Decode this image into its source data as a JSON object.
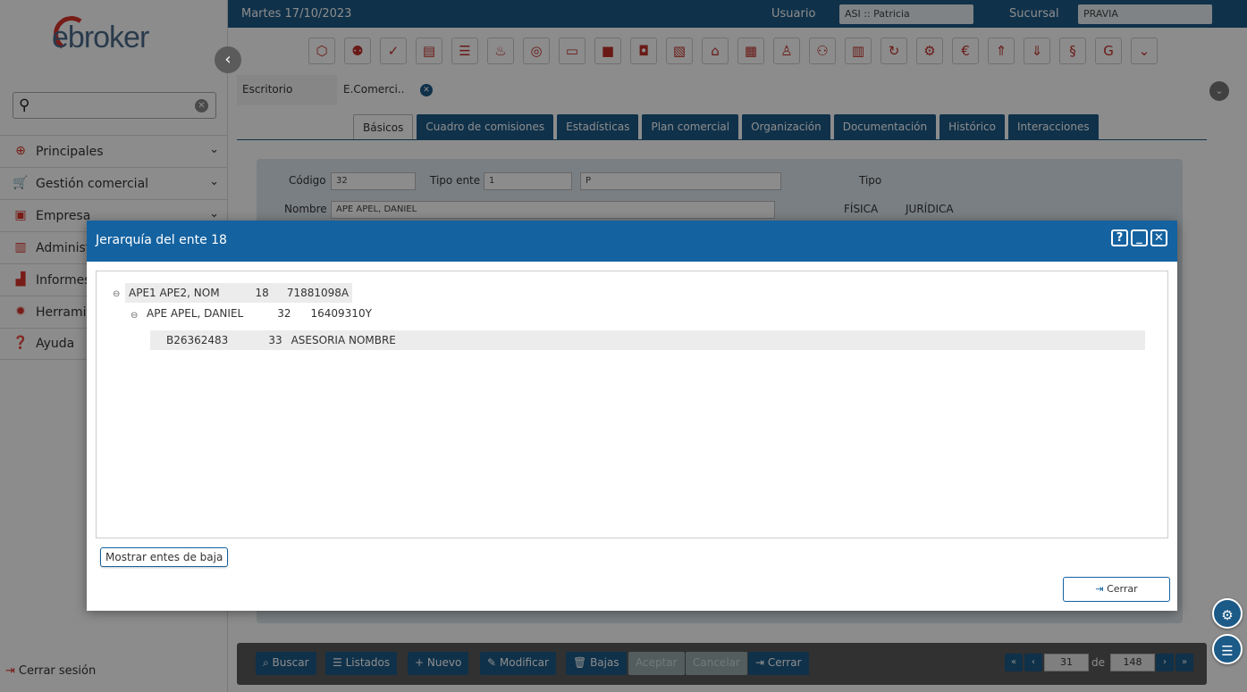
{
  "app": {
    "logo_text": "ebroker"
  },
  "sidebar": {
    "search_placeholder": "",
    "items": [
      {
        "label": "Principales",
        "icon": "plus-circle-icon"
      },
      {
        "label": "Gestión comercial",
        "icon": "cart-icon"
      },
      {
        "label": "Empresa",
        "icon": "briefcase-icon"
      },
      {
        "label": "Administ",
        "icon": "admin-icon"
      },
      {
        "label": "Informes",
        "icon": "bar-chart-icon"
      },
      {
        "label": "Herramie",
        "icon": "gear-icon"
      },
      {
        "label": "Ayuda",
        "icon": "help-icon"
      }
    ],
    "logout": "Cerrar sesión"
  },
  "topbar": {
    "date": "Martes 17/10/2023",
    "user_label": "Usuario",
    "user_value": "ASI :: Patricia",
    "branch_label": "Sucursal",
    "branch_value": "PRAVIA"
  },
  "open_tabs": [
    {
      "label": "Escritorio"
    },
    {
      "label": "E.Comerci.."
    }
  ],
  "subtabs": [
    "Básicos",
    "Cuadro de comisiones",
    "Estadísticas",
    "Plan comercial",
    "Organización",
    "Documentación",
    "Histórico",
    "Interacciones"
  ],
  "form": {
    "codigo_label": "Código",
    "codigo_value": "32",
    "tipo_ente_label": "Tipo ente",
    "tipo_ente_value": "1",
    "tipo_ente_desc": "P",
    "tipo_label": "Tipo",
    "nombre_label": "Nombre",
    "nombre_value": "APE APEL, DANIEL",
    "fisica": "FÍSICA",
    "juridica": "JURÍDICA"
  },
  "bottom": {
    "buscar": "Buscar",
    "listados": "Listados",
    "nuevo": "Nuevo",
    "modificar": "Modificar",
    "bajas": "Bajas",
    "aceptar": "Aceptar",
    "cancelar": "Cancelar",
    "cerrar": "Cerrar",
    "page": "31",
    "de": "de",
    "total": "148"
  },
  "dialog": {
    "title": "Jerarquía del ente 18",
    "nodes": [
      {
        "name": "APE1 APE2, NOM",
        "id": "18",
        "doc": "71881098A"
      },
      {
        "name": "APE APEL, DANIEL",
        "id": "32",
        "doc": "16409310Y"
      },
      {
        "name": "B26362483",
        "id": "33",
        "doc": "ASESORIA NOMBRE"
      }
    ],
    "show_button": "Mostrar entes de baja",
    "close_button": "Cerrar"
  }
}
